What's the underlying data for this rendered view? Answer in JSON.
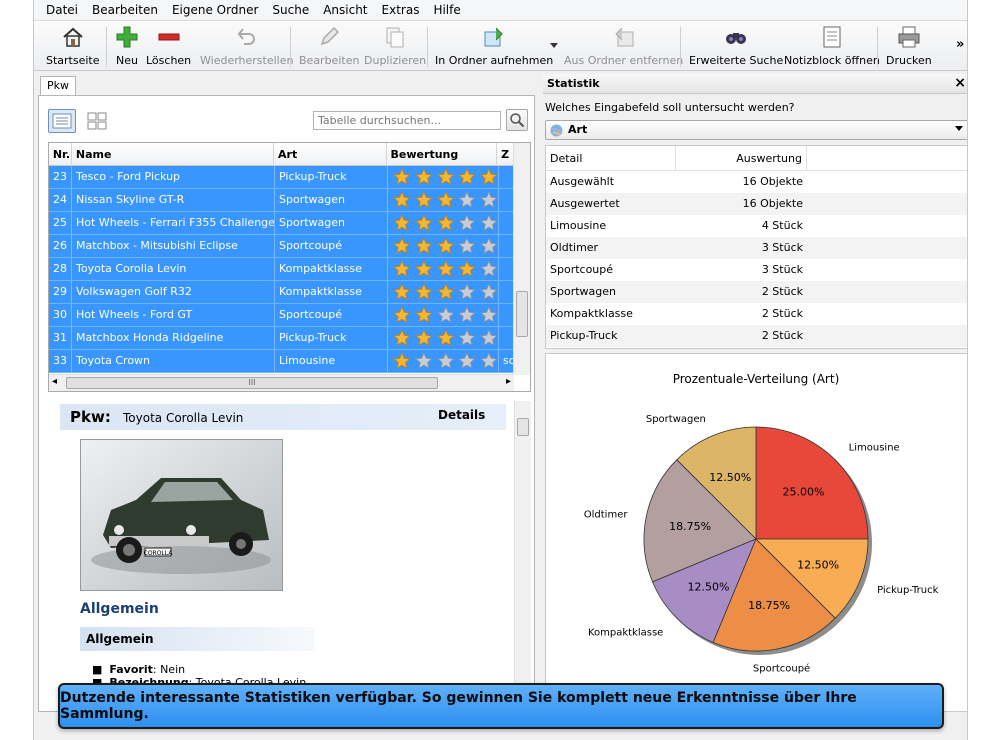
{
  "menu": [
    "Datei",
    "Bearbeiten",
    "Eigene Ordner",
    "Suche",
    "Ansicht",
    "Extras",
    "Hilfe"
  ],
  "toolbar": {
    "startseite": "Startseite",
    "neu": "Neu",
    "loeschen": "Löschen",
    "wiederherstellen": "Wiederherstellen",
    "bearbeiten": "Bearbeiten",
    "duplizieren": "Duplizieren",
    "in_ordner": "In Ordner aufnehmen",
    "aus_ordner": "Aus Ordner entfernen",
    "erweiterte_suche": "Erweiterte Suche",
    "notizblock": "Notizblock öffnen",
    "drucken": "Drucken",
    "more": "»"
  },
  "left_tab": "Pkw",
  "search": {
    "placeholder": "Tabelle durchsuchen..."
  },
  "table": {
    "headers": {
      "nr": "Nr.",
      "name": "Name",
      "art": "Art",
      "bewertung": "Bewertung",
      "z": "Z"
    },
    "rows": [
      {
        "nr": "23",
        "name": "Tesco - Ford Pickup",
        "art": "Pickup-Truck",
        "stars": 5,
        "z": ""
      },
      {
        "nr": "24",
        "name": "Nissan Skyline GT-R",
        "art": "Sportwagen",
        "stars": 3,
        "z": ""
      },
      {
        "nr": "25",
        "name": "Hot Wheels - Ferrari F355 Challenge",
        "art": "Sportwagen",
        "stars": 3,
        "z": ""
      },
      {
        "nr": "26",
        "name": "Matchbox - Mitsubishi Eclipse",
        "art": "Sportcoupé",
        "stars": 3,
        "z": ""
      },
      {
        "nr": "28",
        "name": "Toyota Corolla Levin",
        "art": "Kompaktklasse",
        "stars": 4,
        "z": ""
      },
      {
        "nr": "29",
        "name": "Volkswagen Golf R32",
        "art": "Kompaktklasse",
        "stars": 3,
        "z": ""
      },
      {
        "nr": "30",
        "name": "Hot Wheels - Ford GT",
        "art": "Sportcoupé",
        "stars": 2,
        "z": ""
      },
      {
        "nr": "31",
        "name": "Matchbox Honda Ridgeline",
        "art": "Pickup-Truck",
        "stars": 3,
        "z": ""
      },
      {
        "nr": "33",
        "name": "Toyota Crown",
        "art": "Limousine",
        "stars": 1,
        "z": "sc"
      }
    ],
    "hscroll_grip": "III"
  },
  "details": {
    "title_label": "Pkw:",
    "title_value": "Toyota Corolla Levin",
    "details_label": "Details",
    "section": "Allgemein",
    "subhead": "Allgemein",
    "fields": [
      {
        "label": "Favorit",
        "value": ": Nein"
      },
      {
        "label": "Bezeichnung",
        "value": ": Toyota Corolla Levin"
      }
    ],
    "plate_text": "COROLLA"
  },
  "statistik": {
    "title": "Statistik",
    "close": "×",
    "question": "Welches Eingabefeld soll untersucht werden?",
    "selected": "Art",
    "headers": {
      "detail": "Detail",
      "auswertung": "Auswertung"
    },
    "rows": [
      {
        "detail": "Ausgewählt",
        "value": "16 Objekte"
      },
      {
        "detail": "Ausgewertet",
        "value": "16 Objekte"
      },
      {
        "detail": "Limousine",
        "value": "4 Stück"
      },
      {
        "detail": "Oldtimer",
        "value": "3 Stück"
      },
      {
        "detail": "Sportcoupé",
        "value": "3 Stück"
      },
      {
        "detail": "Sportwagen",
        "value": "2 Stück"
      },
      {
        "detail": "Kompaktklasse",
        "value": "2 Stück"
      },
      {
        "detail": "Pickup-Truck",
        "value": "2 Stück"
      }
    ]
  },
  "chart_data": {
    "type": "pie",
    "title": "Prozentuale-Verteilung (Art)",
    "slices": [
      {
        "label": "Limousine",
        "value": 25.0,
        "pct_label": "25.00%",
        "color": "#e8483a"
      },
      {
        "label": "Sportwagen",
        "value": 12.5,
        "pct_label": "12.50%",
        "color": "#dcb566"
      },
      {
        "label": "Oldtimer",
        "value": 18.75,
        "pct_label": "18.75%",
        "color": "#b39ea0"
      },
      {
        "label": "Kompaktklasse",
        "value": 12.5,
        "pct_label": "12.50%",
        "color": "#a88cc4"
      },
      {
        "label": "Sportcoupé",
        "value": 18.75,
        "pct_label": "18.75%",
        "color": "#ed8e47"
      },
      {
        "label": "Pickup-Truck",
        "value": 12.5,
        "pct_label": "12.50%",
        "color": "#f8ad54"
      }
    ]
  },
  "banner": "Dutzende interessante Statistiken verfügbar. So gewinnen Sie komplett neue Erkenntnisse über Ihre Sammlung."
}
